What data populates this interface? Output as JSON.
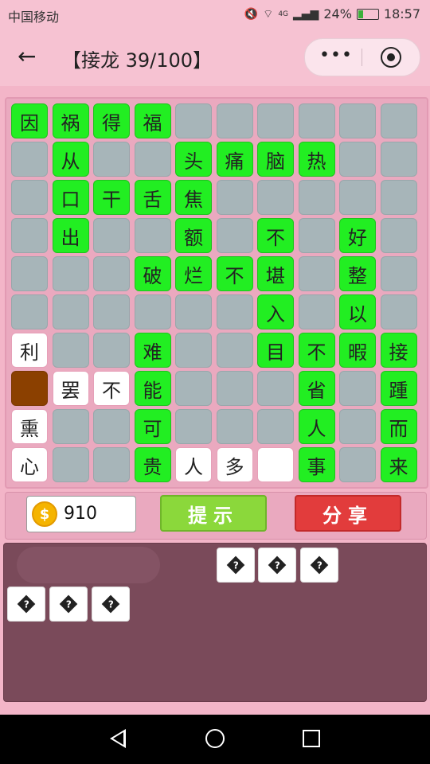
{
  "status_bar": {
    "carrier": "中国移动",
    "battery": "24%",
    "time": "18:57",
    "network": "4G",
    "icons": [
      "mute-icon",
      "wifi-icon",
      "signal-icon",
      "battery-icon"
    ]
  },
  "header": {
    "title": "【接龙 39/100】",
    "back_icon": "back-arrow-icon",
    "more_icon": "more-dots-icon",
    "close_icon": "close-target-icon"
  },
  "board": {
    "rows": 10,
    "cols": 10,
    "cells": [
      [
        "因",
        "祸",
        "得",
        "福",
        "",
        "",
        "",
        "",
        "",
        ""
      ],
      [
        "",
        "从",
        "",
        "",
        "头",
        "痛",
        "脑",
        "热",
        "",
        ""
      ],
      [
        "",
        "口",
        "干",
        "舌",
        "焦",
        "",
        "",
        "",
        "",
        ""
      ],
      [
        "",
        "出",
        "",
        "",
        "额",
        "",
        "不",
        "",
        "好",
        ""
      ],
      [
        "",
        "",
        "",
        "破",
        "烂",
        "不",
        "堪",
        "",
        "整",
        ""
      ],
      [
        "",
        "",
        "",
        "",
        "",
        "",
        "入",
        "",
        "以",
        ""
      ],
      [
        "利",
        "",
        "",
        "难",
        "",
        "",
        "目",
        "不",
        "暇",
        "接"
      ],
      [
        "",
        "罢",
        "不",
        "能",
        "",
        "",
        "",
        "省",
        "",
        "踵"
      ],
      [
        "熏",
        "",
        "",
        "可",
        "",
        "",
        "",
        "人",
        "",
        "而"
      ],
      [
        "心",
        "",
        "",
        "贵",
        "人",
        "多",
        "",
        "事",
        "",
        "来"
      ]
    ],
    "cell_types": [
      [
        "f",
        "f",
        "f",
        "f",
        "e",
        "e",
        "e",
        "e",
        "e",
        "e"
      ],
      [
        "e",
        "f",
        "e",
        "e",
        "f",
        "f",
        "f",
        "f",
        "e",
        "e"
      ],
      [
        "e",
        "f",
        "f",
        "f",
        "f",
        "e",
        "e",
        "e",
        "e",
        "e"
      ],
      [
        "e",
        "f",
        "e",
        "e",
        "f",
        "e",
        "f",
        "e",
        "f",
        "e"
      ],
      [
        "e",
        "e",
        "e",
        "f",
        "f",
        "f",
        "f",
        "e",
        "f",
        "e"
      ],
      [
        "e",
        "e",
        "e",
        "e",
        "e",
        "e",
        "f",
        "e",
        "f",
        "e"
      ],
      [
        "w",
        "e",
        "e",
        "f",
        "e",
        "e",
        "f",
        "f",
        "f",
        "f"
      ],
      [
        "b",
        "w",
        "w",
        "f",
        "e",
        "e",
        "e",
        "f",
        "e",
        "f"
      ],
      [
        "w",
        "e",
        "e",
        "f",
        "e",
        "e",
        "e",
        "f",
        "e",
        "f"
      ],
      [
        "w",
        "e",
        "e",
        "f",
        "w",
        "w",
        "w",
        "f",
        "e",
        "f"
      ]
    ]
  },
  "controls": {
    "coins": "910",
    "hint_label": "提示",
    "share_label": "分享"
  },
  "answer_tiles": [
    "�",
    "�",
    "�",
    "�",
    "�",
    "�"
  ],
  "colors": {
    "filled": "#22ee22",
    "empty": "#a7b5b9",
    "selected": "#8b4000",
    "hint": "#8bd83b",
    "share": "#e23c3c"
  }
}
